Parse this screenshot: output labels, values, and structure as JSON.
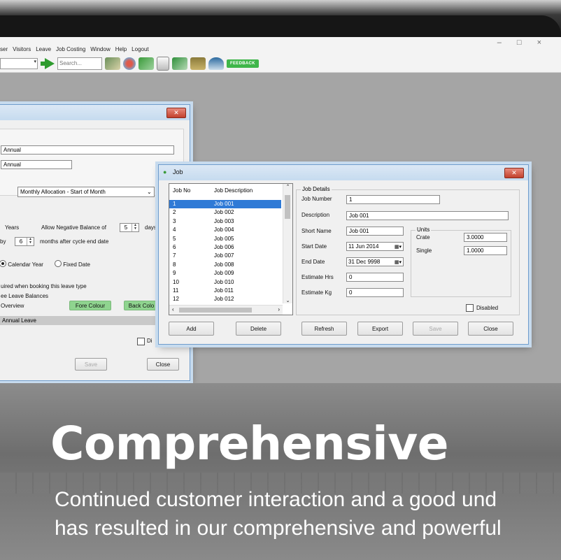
{
  "window_controls": {
    "min": "–",
    "max": "□",
    "close": "×"
  },
  "menu": [
    "ser",
    "Visitors",
    "Leave",
    "Job Costing",
    "Window",
    "Help",
    "Logout"
  ],
  "toolbar": {
    "search_placeholder": "Search...",
    "feedback": "FEEDBACK"
  },
  "leave_dialog": {
    "close": "✕",
    "name_value": "Annual",
    "short_value": "Annual",
    "allocation_value": "Monthly Allocation - Start of Month",
    "years_label": "Years",
    "neg_balance_label": "Allow Negative Balance of",
    "neg_balance_value": "5",
    "days_label": "days",
    "by_label": "by",
    "by_value": "6",
    "months_label": "months after cycle end date",
    "calendar_year": "Calendar Year",
    "fixed_date": "Fixed Date",
    "required_text": "uired when booking this leave type",
    "balances_text": "ee Leave Balances",
    "overview_text": "Overview",
    "fore_colour": "Fore Colour",
    "back_colour": "Back Colo",
    "annual_leave": "Annual Leave",
    "disabled_partial": "Di",
    "save": "Save",
    "close_btn": "Close"
  },
  "job_dialog": {
    "title": "Job",
    "close": "✕",
    "list": {
      "headers": [
        "Job No",
        "Job Description"
      ],
      "rows": [
        [
          "1",
          "Job 001"
        ],
        [
          "2",
          "Job 002"
        ],
        [
          "3",
          "Job 003"
        ],
        [
          "4",
          "Job 004"
        ],
        [
          "5",
          "Job 005"
        ],
        [
          "6",
          "Job 006"
        ],
        [
          "7",
          "Job 007"
        ],
        [
          "8",
          "Job 008"
        ],
        [
          "9",
          "Job 009"
        ],
        [
          "10",
          "Job 010"
        ],
        [
          "11",
          "Job 011"
        ],
        [
          "12",
          "Job 012"
        ]
      ]
    },
    "details_title": "Job Details",
    "labels": {
      "job_number": "Job Number",
      "description": "Description",
      "short_name": "Short Name",
      "start_date": "Start Date",
      "end_date": "End Date",
      "estimate_hrs": "Estimate Hrs",
      "estimate_kg": "Estimate Kg",
      "units": "Units",
      "crate": "Crate",
      "single": "Single",
      "disabled": "Disabled"
    },
    "values": {
      "job_number": "1",
      "description": "Job 001",
      "short_name": "Job 001",
      "start_date": "11 Jun 2014",
      "end_date": "31 Dec 9998",
      "estimate_hrs": "0",
      "estimate_kg": "0",
      "crate": "3.0000",
      "single": "1.0000"
    },
    "buttons": {
      "add": "Add",
      "delete": "Delete",
      "refresh": "Refresh",
      "export": "Export",
      "save": "Save",
      "close": "Close"
    }
  },
  "overlay": {
    "headline": "Comprehensive",
    "line1": "Continued customer interaction and a good und",
    "line2": "has resulted in our comprehensive and powerful"
  }
}
